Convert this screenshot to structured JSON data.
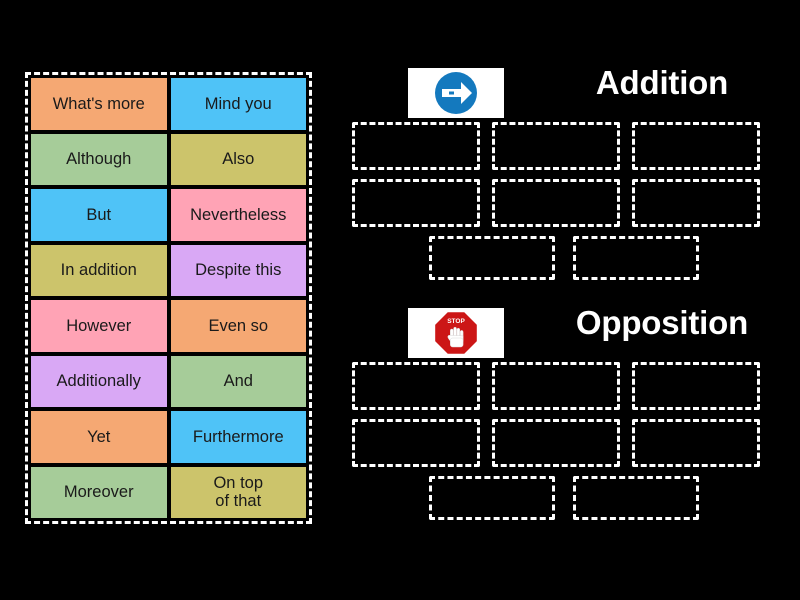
{
  "activity": {
    "type": "drag-and-drop-sorting",
    "background_color": "#000000"
  },
  "word_bank": {
    "border_style": "white-dashed",
    "tiles": [
      {
        "label": "What's more",
        "color": "#F5A873"
      },
      {
        "label": "Mind you",
        "color": "#4FC3F7"
      },
      {
        "label": "Although",
        "color": "#A6CC99"
      },
      {
        "label": "Also",
        "color": "#CCC46B"
      },
      {
        "label": "But",
        "color": "#4FC3F7"
      },
      {
        "label": "Nevertheless",
        "color": "#FFA3B5"
      },
      {
        "label": "In addition",
        "color": "#CCC46B"
      },
      {
        "label": "Despite this",
        "color": "#D9A8F5"
      },
      {
        "label": "However",
        "color": "#FFA3B5"
      },
      {
        "label": "Even so",
        "color": "#F5A873"
      },
      {
        "label": "Additionally",
        "color": "#D9A8F5"
      },
      {
        "label": "And",
        "color": "#A6CC99"
      },
      {
        "label": "Yet",
        "color": "#F5A873"
      },
      {
        "label": "Furthermore",
        "color": "#4FC3F7"
      },
      {
        "label": "Moreover",
        "color": "#A6CC99"
      },
      {
        "label": "On top\nof that",
        "color": "#CCC46B"
      }
    ]
  },
  "categories": [
    {
      "title": "Addition",
      "icon": "blue-right-arrow-sign-icon",
      "icon_colors": {
        "circle": "#1479BE",
        "arrow": "#FFFFFF"
      },
      "dropzone_rows": [
        3,
        3,
        2
      ],
      "dropzone_count": 8
    },
    {
      "title": "Opposition",
      "icon": "red-stop-hand-sign-icon",
      "icon_colors": {
        "octagon": "#CC1616",
        "hand": "#FFFFFF"
      },
      "icon_text": "STOP",
      "dropzone_rows": [
        3,
        3,
        2
      ],
      "dropzone_count": 8
    }
  ]
}
